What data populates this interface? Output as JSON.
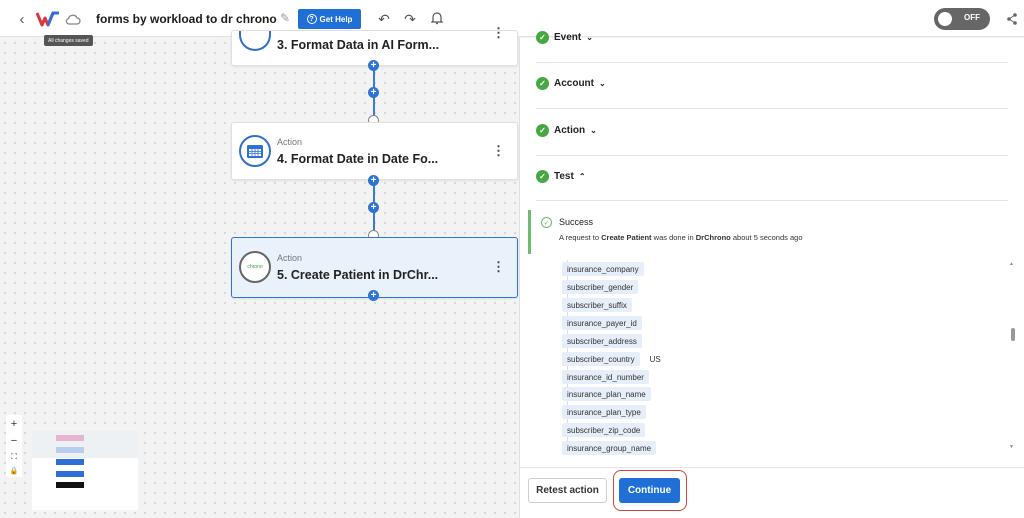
{
  "header": {
    "back": "‹",
    "title": "forms by workload to dr chrono",
    "help_label": "Get Help",
    "toggle_label": "OFF",
    "tooltip": "All changes saved"
  },
  "canvas": {
    "nodes": [
      {
        "type": "",
        "title": "3. Format Data in AI Form..."
      },
      {
        "type": "Action",
        "title": "4. Format Date in Date Fo..."
      },
      {
        "type": "Action",
        "title": "5. Create Patient in DrChr..."
      }
    ],
    "app_icon_text": "chrono",
    "zoom": [
      "+",
      "−",
      "⛶",
      "🔒"
    ]
  },
  "panel": {
    "sections": [
      {
        "label": "Event"
      },
      {
        "label": "Account"
      },
      {
        "label": "Action"
      },
      {
        "label": "Test"
      }
    ],
    "success": {
      "title": "Success",
      "msg_prefix": "A request to ",
      "msg_bold1": "Create Patient",
      "msg_mid": " was done in ",
      "msg_bold2": "DrChrono",
      "msg_suffix": " about 5 seconds ago"
    },
    "fields": [
      {
        "name": "insurance_company",
        "value": ""
      },
      {
        "name": "subscriber_gender",
        "value": ""
      },
      {
        "name": "subscriber_suffix",
        "value": ""
      },
      {
        "name": "insurance_payer_id",
        "value": ""
      },
      {
        "name": "subscriber_address",
        "value": ""
      },
      {
        "name": "subscriber_country",
        "value": "US"
      },
      {
        "name": "insurance_id_number",
        "value": ""
      },
      {
        "name": "insurance_plan_name",
        "value": ""
      },
      {
        "name": "insurance_plan_type",
        "value": ""
      },
      {
        "name": "subscriber_zip_code",
        "value": ""
      },
      {
        "name": "insurance_group_name",
        "value": ""
      }
    ],
    "retest_label": "Retest action",
    "continue_label": "Continue"
  },
  "colors": {
    "accent": "#1f6fd6",
    "success": "#47a843",
    "highlight": "#d2453a"
  }
}
